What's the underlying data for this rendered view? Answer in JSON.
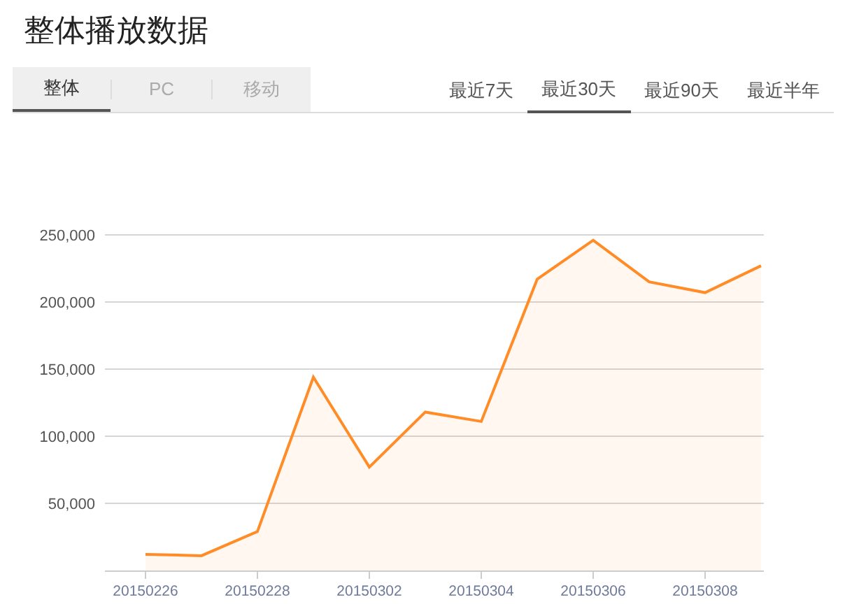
{
  "title": "整体播放数据",
  "platform_tabs": [
    {
      "label": "整体",
      "selected": true
    },
    {
      "label": "PC",
      "selected": false
    },
    {
      "label": "移动",
      "selected": false
    }
  ],
  "range_tabs": [
    {
      "label": "最近7天",
      "selected": false
    },
    {
      "label": "最近30天",
      "selected": true
    },
    {
      "label": "最近90天",
      "selected": false
    },
    {
      "label": "最近半年",
      "selected": false
    }
  ],
  "chart_data": {
    "type": "area",
    "categories": [
      "20150226",
      null,
      "20150228",
      null,
      "20150302",
      null,
      "20150304",
      null,
      "20150306",
      null,
      "20150308",
      null
    ],
    "grid": true,
    "series": [
      {
        "color": "#ff8c26",
        "values": [
          12000,
          11000,
          29000,
          144000,
          77000,
          118000,
          111000,
          217000,
          246000,
          215000,
          207000,
          227000
        ]
      }
    ],
    "ylim": [
      0,
      250000
    ],
    "yticks": [
      {
        "value": 50000,
        "label": "50,000"
      },
      {
        "value": 100000,
        "label": "100,000"
      },
      {
        "value": 150000,
        "label": "150,000"
      },
      {
        "value": 200000,
        "label": "200,000"
      },
      {
        "value": 250000,
        "label": "250,000"
      }
    ]
  }
}
